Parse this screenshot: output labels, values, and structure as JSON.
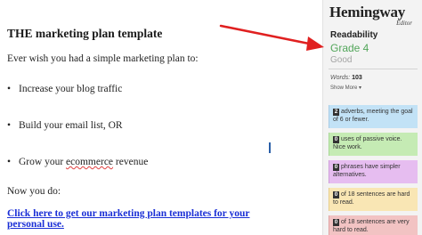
{
  "document": {
    "title": "THE marketing plan template",
    "intro": "Ever wish you had a simple marketing plan to:",
    "bullets": [
      "Increase your blog traffic",
      "Build your email list, OR",
      {
        "before": "Grow your ",
        "misspelled": "ecommerce",
        "after": " revenue"
      }
    ],
    "now_do": "Now you do:",
    "cta": "Click here to get our marketing plan templates for your personal use."
  },
  "sidebar": {
    "logo": "Hemingway",
    "logo_sub": "Editor",
    "readability_label": "Readability",
    "grade": "Grade 4",
    "grade_word": "Good",
    "words_label": "Words:",
    "words_count": "103",
    "show_more": "Show More",
    "cards": [
      {
        "badge": "2",
        "text": "adverbs, meeting the goal of 6 or fewer."
      },
      {
        "badge": "0",
        "text": "uses of passive voice. Nice work."
      },
      {
        "badge": "0",
        "text": "phrases have simpler alternatives."
      },
      {
        "badge": "0",
        "text": "of 18 sentences are hard to read."
      },
      {
        "badge": "0",
        "text": "of 18 sentences are very hard to read."
      }
    ]
  },
  "colors": {
    "grade": "#52a65a",
    "link": "#1a2fd6",
    "arrow": "#e02020",
    "adverbs": "#c2e2f6",
    "passive": "#c5ebb4",
    "phrases": "#e6bdf0",
    "hard": "#f9e6b4",
    "very_hard": "#f2c3c3"
  }
}
